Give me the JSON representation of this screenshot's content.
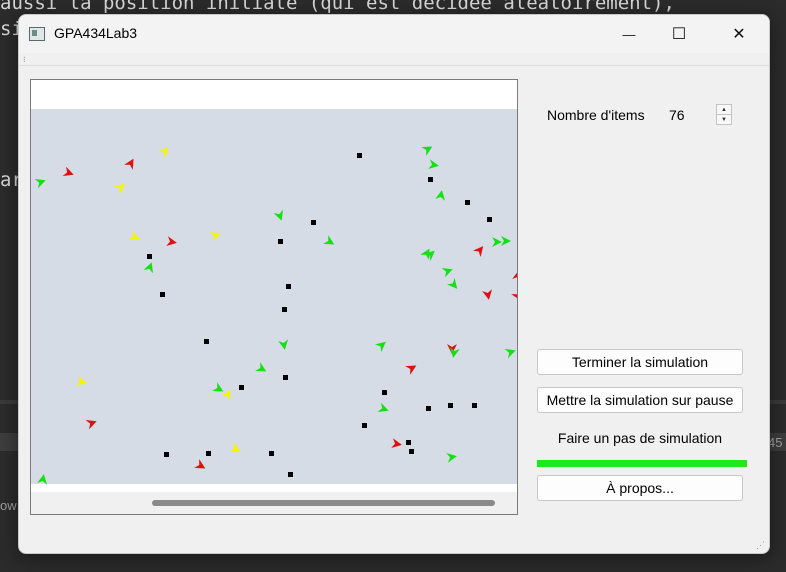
{
  "background": {
    "code_line_1": "aussi la position initiale (qui est décidée aléatoirement),",
    "code_line_2": "si",
    "code_fragment": "ar",
    "ghost_number": "45",
    "ghost_text": "ow"
  },
  "window": {
    "title": "GPA434Lab3",
    "controls": {
      "minimize": "—",
      "maximize": "☐",
      "close": "✕"
    }
  },
  "panel": {
    "items_label": "Nombre d'items",
    "items_value": "76"
  },
  "buttons": {
    "stop": "Terminer la simulation",
    "pause": "Mettre la simulation sur pause",
    "step": "Faire un pas de simulation",
    "about": "À propos..."
  },
  "progress": {
    "fraction": 1.0,
    "color": "#1ee81e"
  },
  "colors": {
    "scene_background": "#d5dce5",
    "green": "#14e014",
    "red": "#e01010",
    "yellow": "#f5f500",
    "food": "#000000"
  },
  "scene": {
    "item_count_shown": 76,
    "item_kinds": [
      "arrow-green",
      "arrow-red",
      "arrow-yellow",
      "food-dot"
    ]
  }
}
